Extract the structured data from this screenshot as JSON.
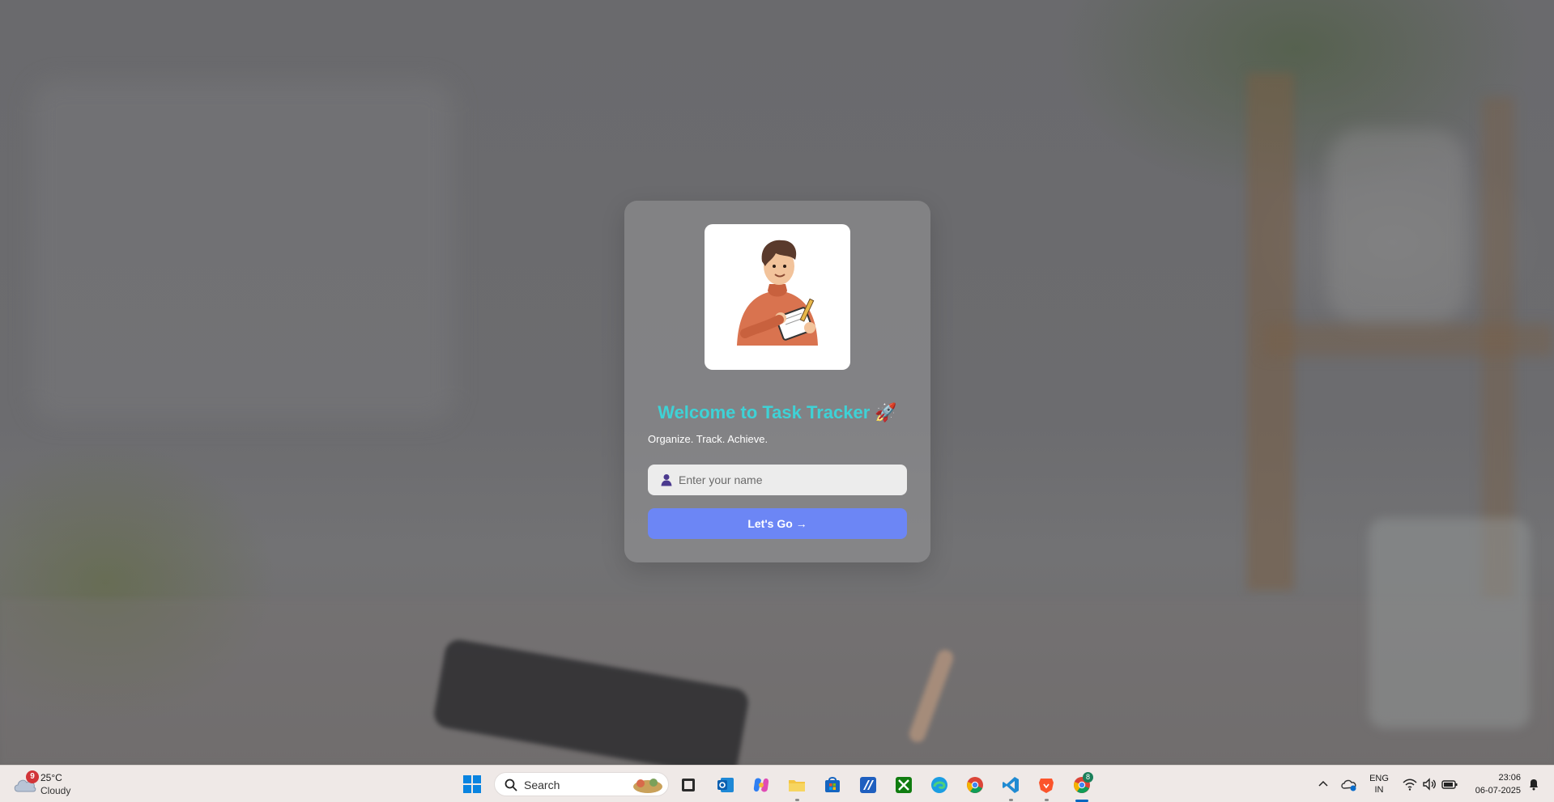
{
  "welcome": {
    "title": "Welcome to Task Tracker 🚀",
    "subtitle": "Organize. Track. Achieve.",
    "name_input": {
      "value": "",
      "placeholder": "Enter your name"
    },
    "submit_label": "Let's Go →",
    "avatar_icon": "person-writing-notepad-illustration",
    "accent_color": "#3ed2d6",
    "button_color": "#6c86f5"
  },
  "taskbar": {
    "weather": {
      "temp": "25°C",
      "condition": "Cloudy",
      "badge": "9"
    },
    "search_label": "Search",
    "pinned": [
      "task-view-icon",
      "outlook-icon",
      "copilot-icon",
      "file-explorer-icon",
      "microsoft-store-icon",
      "app-icon",
      "xbox-icon",
      "edge-icon",
      "chrome-icon",
      "vscode-icon",
      "brave-icon",
      "chrome-profile-icon"
    ],
    "chrome_profile_badge": "8",
    "language": {
      "line1": "ENG",
      "line2": "IN"
    },
    "clock": {
      "time": "23:06",
      "date": "06-07-2025"
    }
  }
}
